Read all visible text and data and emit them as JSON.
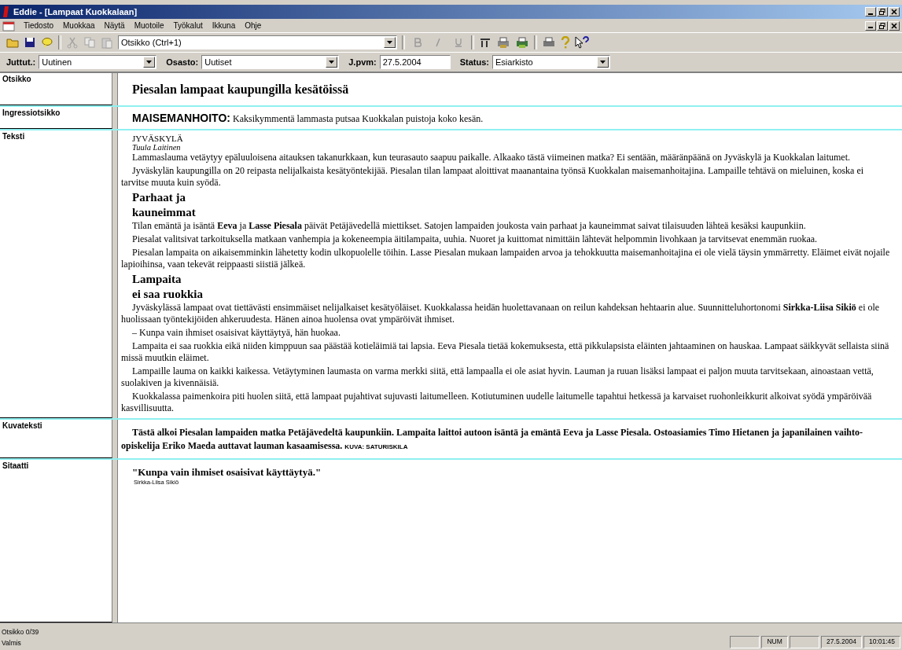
{
  "window": {
    "title": "Eddie - [Lampaat Kuokkalaan]"
  },
  "menu": [
    "Tiedosto",
    "Muokkaa",
    "Näytä",
    "Muotoile",
    "Työkalut",
    "Ikkuna",
    "Ohje"
  ],
  "toolbar": {
    "style_combo": "Otsikko  (Ctrl+1)"
  },
  "fields": [
    {
      "label": "Juttut.:",
      "value": "Uutinen",
      "kind": "combo"
    },
    {
      "label": "Osasto:",
      "value": "Uutiset",
      "kind": "combo"
    },
    {
      "label": "J.pvm:",
      "value": "27.5.2004",
      "kind": "text"
    },
    {
      "label": "Status:",
      "value": "Esiarkisto",
      "kind": "combo"
    }
  ],
  "sections": [
    {
      "label": "Otsikko",
      "kind": "headline",
      "text": "Piesalan lampaat kaupungilla kesätöissä"
    },
    {
      "label": "Ingressiotsikko",
      "kind": "lead",
      "lead_label": "MAISEMANHOITO:",
      "text": "Kaksikymmentä lammasta putsaa Kuokkalan puistoja koko kesän."
    },
    {
      "label": "Teksti",
      "kind": "body",
      "blocks": [
        {
          "kind": "dateline",
          "text": "JYVÄSKYLÄ"
        },
        {
          "kind": "byline",
          "text": "Tuula Laitinen"
        },
        {
          "kind": "para",
          "text": "Lammaslauma vetäytyy epäluuloisena aitauksen takanurkkaan, kun teurasauto saapuu paikalle. Alkaako tästä viimeinen matka? Ei sentään, määränpäänä on Jyväskylä ja Kuokkalan laitumet."
        },
        {
          "kind": "para",
          "text": "Jyväskylän kaupungilla on 20 reipasta nelijalkaista kesätyöntekijää. Piesalan tilan lampaat aloittivat maanantaina työnsä Kuokkalan maisemanhoitajina. Lampaille tehtävä on mieluinen, koska ei tarvitse muuta kuin syödä."
        },
        {
          "kind": "subhead",
          "text": "Parhaat ja"
        },
        {
          "kind": "subhead",
          "text": "kauneimmat"
        },
        {
          "kind": "para",
          "text": "Tilan emäntä ja isäntä **Eeva** ja **Lasse Piesala** päivät Petäjävedellä miettikset. Satojen lampaiden joukosta vain parhaat ja kauneimmat saivat tilaisuuden lähteä kesäksi kaupunkiin."
        },
        {
          "kind": "para",
          "text": "Piesalat valitsivat tarkoituksella matkaan vanhempia ja kokeneempia äitilampaita, uuhia. Nuoret ja kuittomat nimittäin lähtevät helpommin livohkaan ja tarvitsevat enemmän ruokaa."
        },
        {
          "kind": "para",
          "text": "Piesalan lampaita on aikaisemminkin lähetetty kodin ulkopuolelle töihin. Lasse Piesalan mukaan lampaiden arvoa ja tehokkuutta maisemanhoitajina ei ole vielä täysin ymmärretty. Eläimet eivät nojaile lapioihinsa, vaan tekevät reippaasti siistiä jälkeä."
        },
        {
          "kind": "subhead",
          "text": "Lampaita"
        },
        {
          "kind": "subhead",
          "text": "ei saa ruokkia"
        },
        {
          "kind": "para",
          "text": "Jyväskylässä lampaat ovat tiettävästi ensimmäiset nelijalkaiset kesätyöläiset. Kuokkalassa heidän huolettavanaan on reilun kahdeksan hehtaarin alue. Suunnitteluhortonomi **Sirkka-Liisa Sikiö** ei ole huolissaan työntekijöiden ahkeruudesta. Hänen ainoa huolensa ovat ympäröivät ihmiset."
        },
        {
          "kind": "para",
          "text": "– Kunpa vain ihmiset osaisivat käyttäytyä, hän huokaa."
        },
        {
          "kind": "para",
          "text": "Lampaita ei saa ruokkia eikä niiden kimppuun saa päästää kotieläimiä tai lapsia. Eeva Piesala tietää kokemuksesta, että pikkulapsista eläinten jahtaaminen on hauskaa. Lampaat säikkyvät sellaista siinä missä muutkin eläimet."
        },
        {
          "kind": "para",
          "text": "Lampaille lauma on kaikki kaikessa. Vetäytyminen laumasta on varma merkki siitä, että lampaalla ei ole asiat hyvin. Lauman ja ruuan lisäksi lampaat ei paljon muuta tarvitsekaan, ainoastaan vettä, suolakiven ja kivennäisiä."
        },
        {
          "kind": "para",
          "text": "Kuokkalassa paimenkoira piti huolen siitä, että lampaat pujahtivat sujuvasti laitumelleen. Kotiutuminen uudelle laitumelle tapahtui hetkessä ja karvaiset ruohonleikkurit alkoivat syödä ympäröivää kasvillisuutta."
        }
      ]
    },
    {
      "label": "Kuvateksti",
      "kind": "caption",
      "text": "Tästä alkoi Piesalan lampaiden matka Petäjävedeltä kaupunkiin. Lampaita laittoi autoon isäntä ja emäntä Eeva ja Lasse Piesala. Ostoasiamies Timo Hietanen ja japanilainen vaihto-opiskelija Eriko Maeda auttavat lauman kasaamisessa.",
      "credit": "KUVA: SATURISKILA"
    },
    {
      "label": "Sitaatti",
      "kind": "quote",
      "text": "\"Kunpa vain ihmiset osaisivat käyttäytyä.\"",
      "source": "Sirkka-Liisa Sikiö"
    }
  ],
  "status_bar": {
    "left": [
      "Otsikko 0/39",
      "Valmis"
    ],
    "panels": [
      "NUM",
      "27.5.2004",
      "10:01:45"
    ]
  }
}
